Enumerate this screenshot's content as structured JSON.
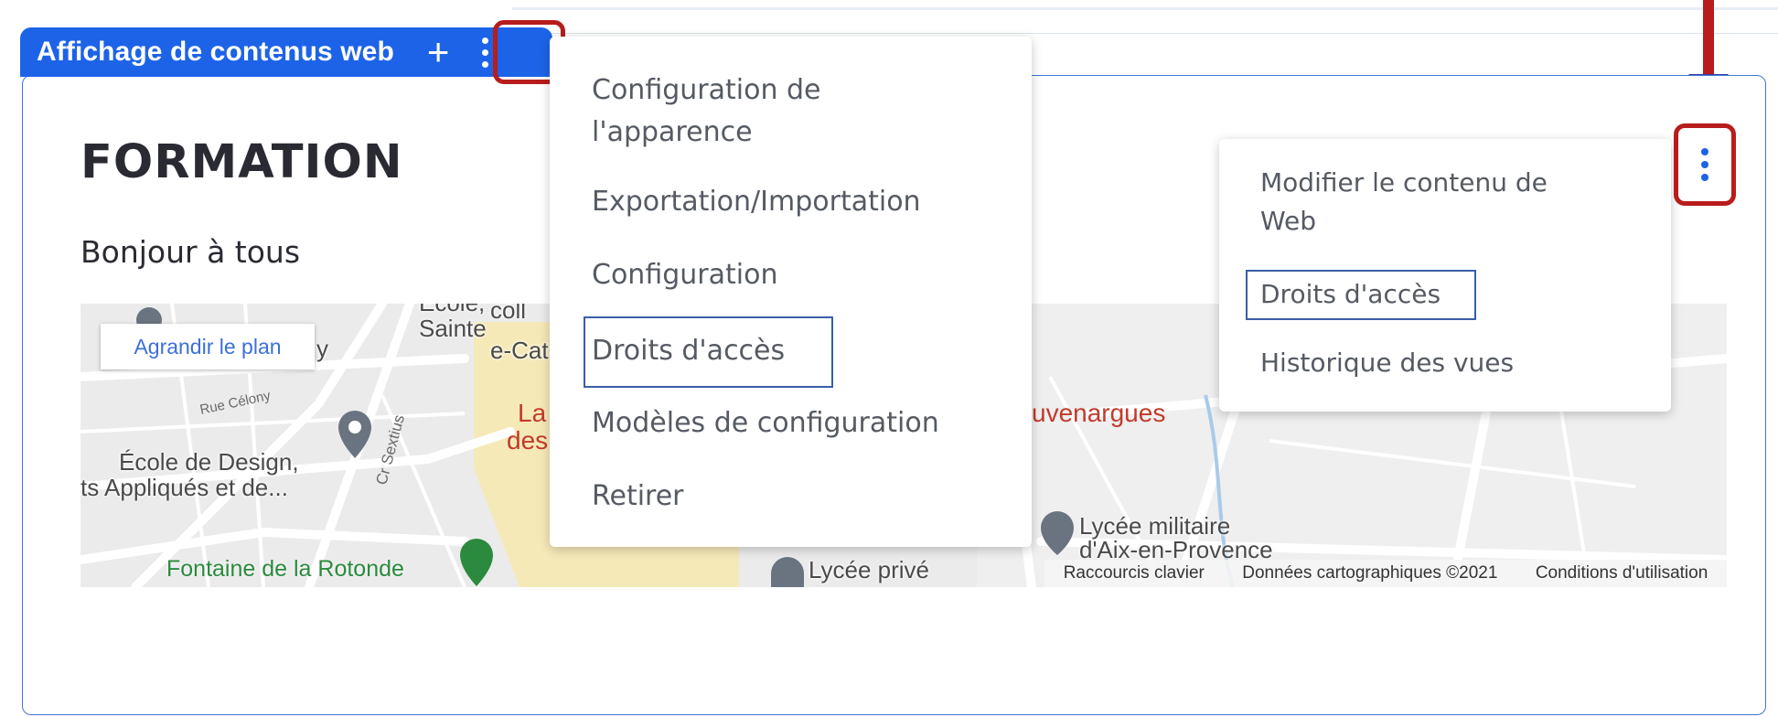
{
  "portlet": {
    "tab_title": "Affichage de contenus web",
    "add_symbol": "+",
    "heading": "FORMATION",
    "body_text": "Bonjour à tous"
  },
  "map": {
    "enlarge_button": "Agrandir le plan",
    "labels": {
      "ecole_design": "École de Design,",
      "arts_appliques": "ts Appliqués et de...",
      "rue_celony": "Rue Célony",
      "cr_sextius": "Cr Sextius",
      "sainte": "Sainte",
      "ecole_top": "Ecole,",
      "catherine": "e-Cat",
      "coll": "coll",
      "la": "La",
      "des": "des",
      "letter_y": "y",
      "fontaine": "Fontaine de la Rotonde",
      "lycee_prive": "Lycée privé",
      "lycee_militaire_1": "Lycée militaire",
      "lycee_militaire_2": "d'Aix-en-Provence",
      "jouvenargues": "uvenargues"
    },
    "footer": {
      "shortcuts": "Raccourcis clavier",
      "data": "Données cartographiques ©2021",
      "terms": "Conditions d'utilisation"
    }
  },
  "menu_portlet": {
    "items": [
      "Configuration de",
      "l'apparence",
      "Exportation/Importation",
      "Configuration",
      "Droits d'accès",
      "Modèles de configuration",
      "Retirer"
    ]
  },
  "menu_content": {
    "items": [
      "Modifier le contenu de",
      "Web",
      "Droits d'accès",
      "Historique des vues"
    ]
  },
  "colors": {
    "accent": "#1d63e8",
    "highlight_red": "#b81c1c",
    "highlight_blue": "#3a5ea8"
  }
}
